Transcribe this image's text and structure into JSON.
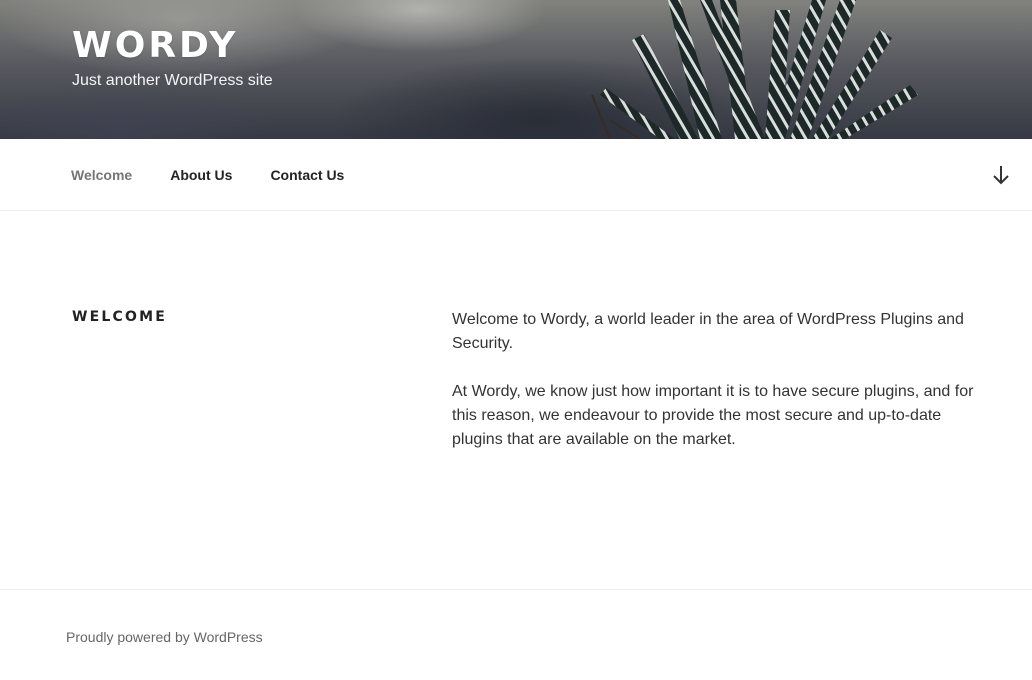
{
  "header": {
    "site_title": "WORDY",
    "site_description": "Just another WordPress site"
  },
  "nav": {
    "items": [
      {
        "label": "Welcome",
        "current": true
      },
      {
        "label": "About Us",
        "current": false
      },
      {
        "label": "Contact Us",
        "current": false
      }
    ],
    "scroll_icon": "arrow-down-icon"
  },
  "page": {
    "title": "WELCOME",
    "paragraphs": [
      "Welcome to Wordy, a world leader in the area of WordPress Plugins and Security.",
      "At Wordy, we know just how important it is to have secure plugins, and for this reason, we endeavour to provide the most secure and up-to-date plugins that are available on the market."
    ]
  },
  "footer": {
    "credit": "Proudly powered by WordPress"
  },
  "colors": {
    "nav_current": "#767676",
    "nav_text": "#222222",
    "body_text": "#333333"
  }
}
